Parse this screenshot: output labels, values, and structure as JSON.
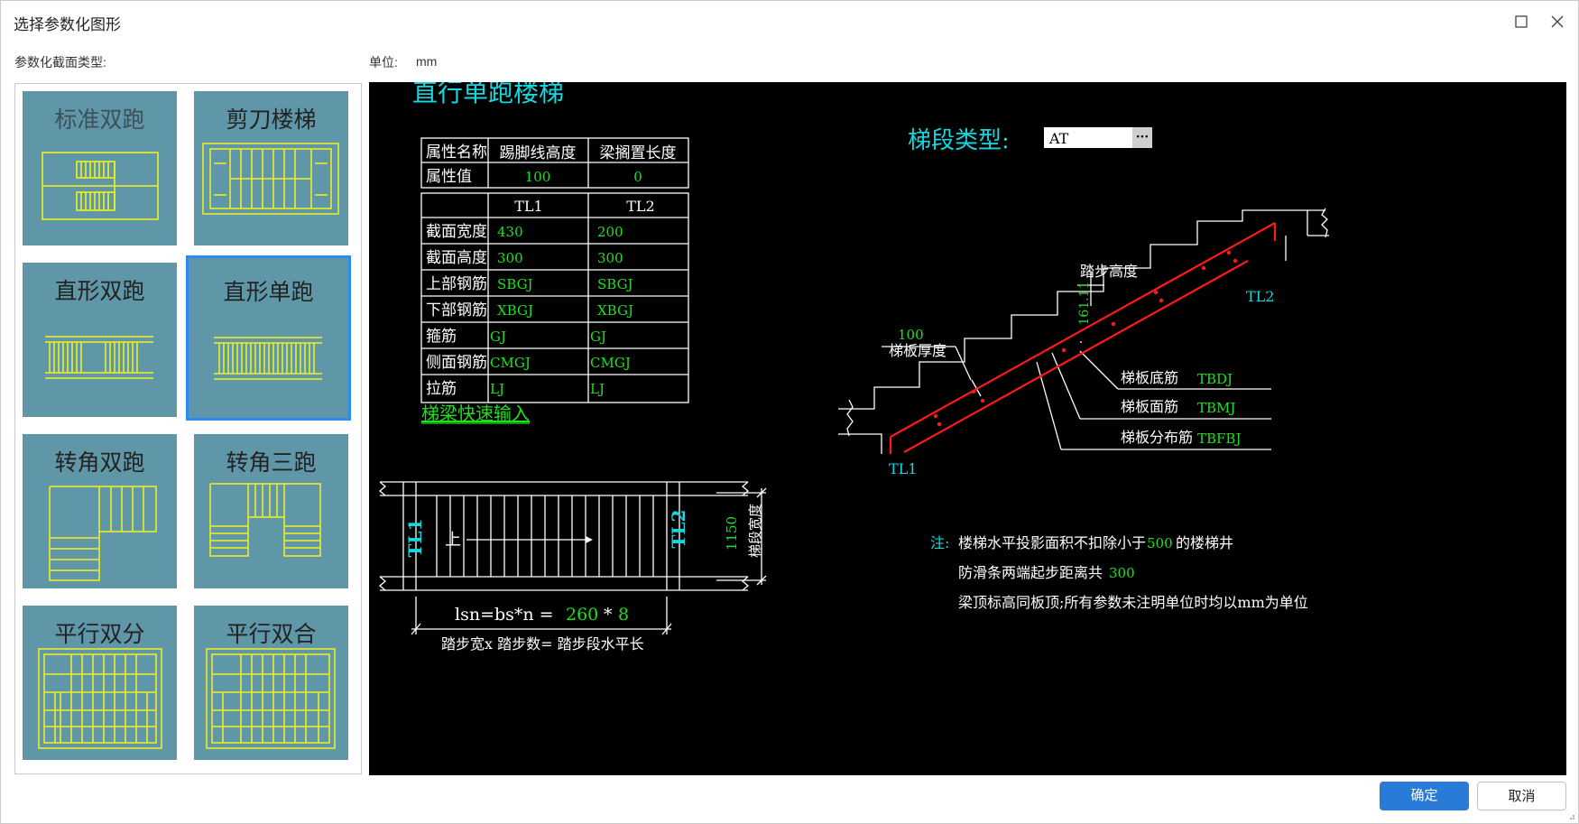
{
  "window": {
    "title": "选择参数化图形"
  },
  "left_label": "参数化截面类型:",
  "unit": {
    "label": "单位:",
    "value": "mm"
  },
  "shapes": [
    {
      "label": "标准双跑",
      "selected": false,
      "icon": "double-run-stair-icon"
    },
    {
      "label": "剪刀楼梯",
      "selected": false,
      "icon": "scissor-stair-icon"
    },
    {
      "label": "直形双跑",
      "selected": false,
      "icon": "straight-double-run-icon"
    },
    {
      "label": "直形单跑",
      "selected": true,
      "icon": "straight-single-run-icon"
    },
    {
      "label": "转角双跑",
      "selected": false,
      "icon": "corner-double-run-icon"
    },
    {
      "label": "转角三跑",
      "selected": false,
      "icon": "corner-triple-run-icon"
    },
    {
      "label": "平行双分",
      "selected": false,
      "icon": "parallel-split-icon"
    },
    {
      "label": "平行双合",
      "selected": false,
      "icon": "parallel-merge-icon"
    }
  ],
  "drawing": {
    "title": "直行单跑楼梯",
    "attr_table": {
      "headers": [
        "属性名称",
        "踢脚线高度",
        "梁搁置长度"
      ],
      "row_label": "属性值",
      "values": [
        "100",
        "0"
      ]
    },
    "beam_table": {
      "columns": [
        "TL1",
        "TL2"
      ],
      "rows": [
        {
          "label": "截面宽度",
          "tl1": "430",
          "tl2": "200"
        },
        {
          "label": "截面高度",
          "tl1": "300",
          "tl2": "300"
        },
        {
          "label": "上部钢筋",
          "tl1": "SBGJ",
          "tl2": "SBGJ"
        },
        {
          "label": "下部钢筋",
          "tl1": "XBGJ",
          "tl2": "XBGJ"
        },
        {
          "label": "箍筋",
          "tl1": "GJ",
          "tl2": "GJ"
        },
        {
          "label": "侧面钢筋",
          "tl1": "CMGJ",
          "tl2": "CMGJ"
        },
        {
          "label": "拉筋",
          "tl1": "LJ",
          "tl2": "LJ"
        }
      ]
    },
    "quick_input": "梯梁快速输入",
    "segment_type_label": "梯段类型:",
    "segment_type_value": "AT",
    "segment_type_button": "···",
    "plan": {
      "tl1": "TL1",
      "tl2": "TL2",
      "up": "上",
      "width_value": "1150",
      "width_label": "梯段宽度",
      "formula_prefix": "lsn=bs*n =",
      "bs": "260",
      "times": "*",
      "n": "8",
      "formula_caption": "踏步宽x 踏步数= 踏步段水平长"
    },
    "section": {
      "step_height_label": "踏步高度",
      "step_height_value": "161.11",
      "thickness_value": "100",
      "thickness_label": "梯板厚度",
      "bottom_bar_label": "梯板底筋",
      "bottom_bar_code": "TBDJ",
      "top_bar_label": "梯板面筋",
      "top_bar_code": "TBMJ",
      "dist_bar_label": "梯板分布筋",
      "dist_bar_code": "TBFBJ",
      "tl1": "TL1",
      "tl2": "TL2"
    },
    "notes": {
      "prefix": "注:",
      "line1_a": "楼梯水平投影面积不扣除小于",
      "line1_val": "500",
      "line1_b": " 的楼梯井",
      "line2_a": "防滑条两端起步距离共",
      "line2_val": "300",
      "line3": "梁顶标高同板顶;所有参数未注明单位时均以mm为单位"
    }
  },
  "buttons": {
    "ok": "确定",
    "cancel": "取消"
  },
  "colors": {
    "tile_bg": "#5f97a8",
    "tile_line": "#f2f21e",
    "selected_border": "#2a8cf0",
    "cad_cyan": "#12d8e0",
    "cad_green": "#1ee11e",
    "cad_red": "#ff1a1a",
    "primary_button": "#2a7ad7"
  }
}
